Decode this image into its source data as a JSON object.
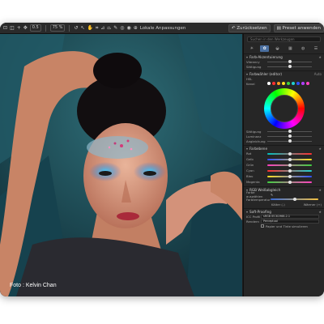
{
  "toolbar": {
    "zoom_value": "0.5",
    "zoom_percent": "75 %",
    "local_adjust_label": "Lokale Anpassungen",
    "undo_label": "Zurücksetzen",
    "preset_label": "Preset anwenden"
  },
  "photo": {
    "credit": "Foto : Kelvin Chan"
  },
  "panel": {
    "search_placeholder": "Suchen in den Werkzeugen",
    "sections": {
      "farbakzentuierung": "Farb-Akzentuierung",
      "vibrancy": "Vibrancy",
      "saettigung": "Sättigung",
      "farbwaehler": "Farbwähler (editor)",
      "farbwaehler_mode": "Auto",
      "hsl": "HSL",
      "kanal": "Kanal",
      "saettigung2": "Sättigung",
      "luminanz": "Luminanz",
      "angleichung": "Angleichung",
      "farbebene": "Farbebene",
      "rot": "Rot",
      "gelb": "Gelb",
      "gruen": "Grün",
      "cyan": "Cyan",
      "blau": "Blau",
      "magenta": "Magenta",
      "rgb": "RGB Weißabgleich",
      "farbe_auswaehlen": "Farbe auswählen",
      "farbtemperatur": "Farbtemperatur",
      "kaelter": "Kälter (-)",
      "waermer": "Wärmer (+)",
      "soft_proofing": "Soft-Proofing",
      "icc_profil": "ICC Profil",
      "icc_value": "sRGB IEC61966-2.1",
      "rendern": "Rendern",
      "rendern_value": "Perceptual",
      "papier": "Papier und Tinte simulieren"
    }
  },
  "colors": {
    "accent": "#4a6fa0",
    "panel_bg": "#262626"
  }
}
